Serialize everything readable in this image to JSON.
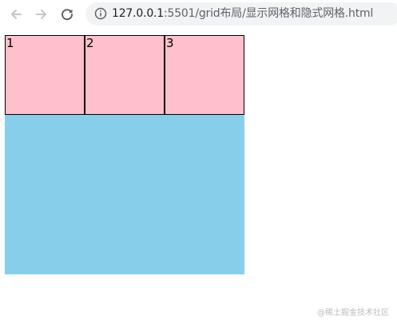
{
  "browser": {
    "back_icon": "arrow-left-icon",
    "forward_icon": "arrow-right-icon",
    "reload_icon": "reload-icon",
    "info_icon": "info-icon",
    "url_host": "127.0.0.1",
    "url_rest": ":5501/grid布局/显示网格和隐式网格.html"
  },
  "page": {
    "grid_items": [
      "1",
      "2",
      "3"
    ],
    "grid_background": "#87ceeb",
    "item_background": "#ffc0cb"
  },
  "watermark": "@稀土掘金技术社区"
}
